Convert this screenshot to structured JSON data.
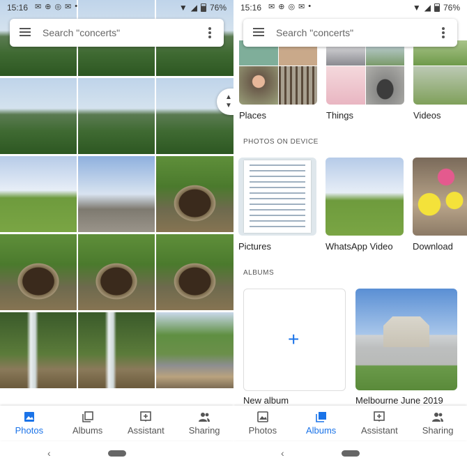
{
  "status_left": {
    "time": "15:16",
    "battery": "76%"
  },
  "status_right": {
    "time": "15:16",
    "battery": "76%"
  },
  "search": {
    "placeholder": "Search \"concerts\""
  },
  "left_nav": [
    {
      "label": "Photos",
      "icon": "photo-icon",
      "active": true
    },
    {
      "label": "Albums",
      "icon": "albums-icon",
      "active": false
    },
    {
      "label": "Assistant",
      "icon": "assistant-icon",
      "active": false
    },
    {
      "label": "Sharing",
      "icon": "sharing-icon",
      "active": false
    }
  ],
  "right_nav": [
    {
      "label": "Photos",
      "icon": "photo-icon",
      "active": false
    },
    {
      "label": "Albums",
      "icon": "albums-icon",
      "active": true
    },
    {
      "label": "Assistant",
      "icon": "assistant-icon",
      "active": false
    },
    {
      "label": "Sharing",
      "icon": "sharing-icon",
      "active": false
    }
  ],
  "categories": [
    "Places",
    "Things",
    "Videos"
  ],
  "photos_on_device": {
    "heading": "PHOTOS ON DEVICE",
    "folders": [
      "Pictures",
      "WhatsApp Video",
      "Download"
    ]
  },
  "albums": {
    "heading": "ALBUMS",
    "items": [
      "New album",
      "Melbourne June 2019"
    ]
  },
  "colors": {
    "accent": "#1a73e8"
  }
}
